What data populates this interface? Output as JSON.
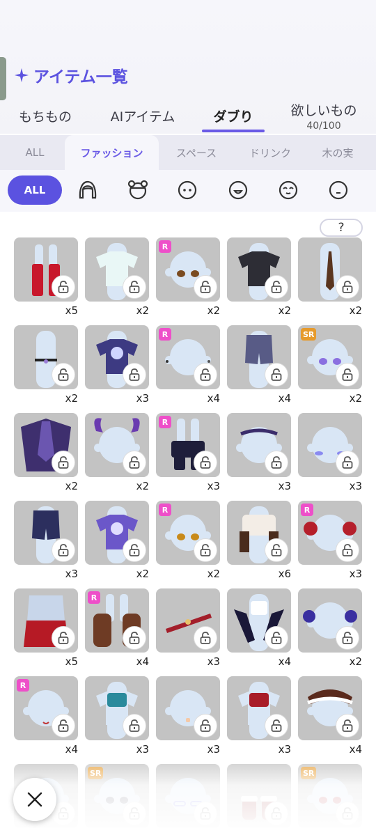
{
  "header": {
    "title": "アイテム一覧",
    "title_icon": "sparkle-icon"
  },
  "main_tabs": [
    {
      "label": "もちもの",
      "sub": ""
    },
    {
      "label": "AIアイテム",
      "sub": ""
    },
    {
      "label": "ダブり",
      "sub": "",
      "active": true
    },
    {
      "label": "欲しいもの",
      "sub": "40/100"
    }
  ],
  "sub_tabs": [
    {
      "label": "ALL"
    },
    {
      "label": "ファッション",
      "active": true
    },
    {
      "label": "スペース"
    },
    {
      "label": "ドリンク"
    },
    {
      "label": "木の実"
    }
  ],
  "filters": {
    "all_label": "ALL",
    "icons": [
      "hair-icon",
      "head-accessory-icon",
      "face-icon",
      "mouth-open-face-icon",
      "closed-eyes-face-icon",
      "small-face-icon"
    ]
  },
  "help": {
    "label": "?"
  },
  "colors": {
    "accent": "#5b52e0",
    "rarity_r": "#ee4fc9",
    "rarity_sr": "#e69a2c",
    "tile": "#c3c3c3"
  },
  "items": [
    {
      "rarity": "",
      "count": "x5",
      "art": "red-boots"
    },
    {
      "rarity": "",
      "count": "x2",
      "art": "white-shirt"
    },
    {
      "rarity": "R",
      "count": "x2",
      "art": "brown-eyes"
    },
    {
      "rarity": "",
      "count": "x2",
      "art": "black-lace-top"
    },
    {
      "rarity": "",
      "count": "x2",
      "art": "tie"
    },
    {
      "rarity": "",
      "count": "x2",
      "art": "choker"
    },
    {
      "rarity": "",
      "count": "x3",
      "art": "navy-tshirt"
    },
    {
      "rarity": "R",
      "count": "x4",
      "art": "piercings"
    },
    {
      "rarity": "",
      "count": "x4",
      "art": "denim-shorts"
    },
    {
      "rarity": "SR",
      "count": "x2",
      "art": "purple-eyes"
    },
    {
      "rarity": "",
      "count": "x2",
      "art": "purple-cape"
    },
    {
      "rarity": "",
      "count": "x2",
      "art": "horns"
    },
    {
      "rarity": "R",
      "count": "x3",
      "art": "black-boots"
    },
    {
      "rarity": "",
      "count": "x3",
      "art": "star-headband"
    },
    {
      "rarity": "",
      "count": "x3",
      "art": "blush"
    },
    {
      "rarity": "",
      "count": "x3",
      "art": "navy-shorts"
    },
    {
      "rarity": "",
      "count": "x2",
      "art": "purple-tshirt"
    },
    {
      "rarity": "R",
      "count": "x2",
      "art": "gold-eyes"
    },
    {
      "rarity": "",
      "count": "x6",
      "art": "fur-top"
    },
    {
      "rarity": "R",
      "count": "x3",
      "art": "red-earmuffs"
    },
    {
      "rarity": "",
      "count": "x5",
      "art": "red-cape"
    },
    {
      "rarity": "R",
      "count": "x4",
      "art": "fur-boots"
    },
    {
      "rarity": "",
      "count": "x3",
      "art": "red-belt"
    },
    {
      "rarity": "",
      "count": "x4",
      "art": "black-gloves"
    },
    {
      "rarity": "",
      "count": "x2",
      "art": "octopus-earrings"
    },
    {
      "rarity": "R",
      "count": "x4",
      "art": "mouth"
    },
    {
      "rarity": "",
      "count": "x3",
      "art": "teal-vest"
    },
    {
      "rarity": "",
      "count": "x3",
      "art": "bandage"
    },
    {
      "rarity": "",
      "count": "x3",
      "art": "red-vest"
    },
    {
      "rarity": "",
      "count": "x4",
      "art": "fur-hat"
    },
    {
      "rarity": "",
      "count": "",
      "art": "plain"
    },
    {
      "rarity": "SR",
      "count": "",
      "art": "lashes-eyes"
    },
    {
      "rarity": "",
      "count": "",
      "art": "glasses"
    },
    {
      "rarity": "",
      "count": "",
      "art": "red-shoes"
    },
    {
      "rarity": "SR",
      "count": "",
      "art": "red-eyes"
    }
  ],
  "close": {
    "icon": "close-icon"
  }
}
